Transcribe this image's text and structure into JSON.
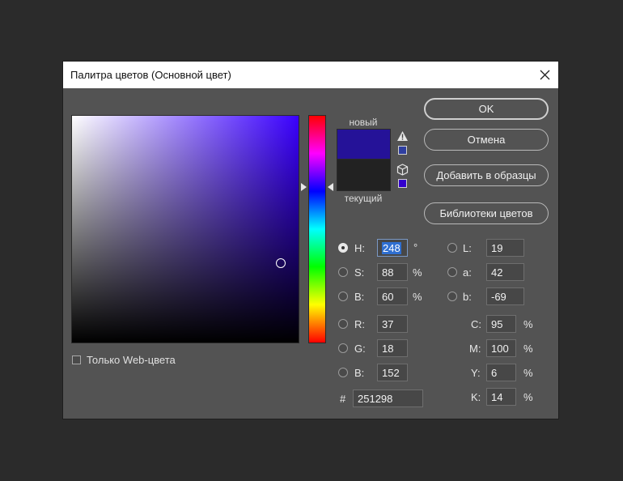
{
  "dialog": {
    "title": "Палитра цветов (Основной цвет)"
  },
  "buttons": {
    "ok": "OK",
    "cancel": "Отмена",
    "add_to_swatches": "Добавить в образцы",
    "color_libraries": "Библиотеки цветов"
  },
  "preview": {
    "new_label": "новый",
    "current_label": "текущий",
    "new_color": "#251298",
    "current_color": "#222222"
  },
  "web_only": {
    "label": "Только Web-цвета",
    "checked": false
  },
  "hsb": {
    "h": {
      "label": "H:",
      "value": "248",
      "unit": "°",
      "selected": true
    },
    "s": {
      "label": "S:",
      "value": "88",
      "unit": "%"
    },
    "b": {
      "label": "B:",
      "value": "60",
      "unit": "%"
    }
  },
  "rgb": {
    "r": {
      "label": "R:",
      "value": "37"
    },
    "g": {
      "label": "G:",
      "value": "18"
    },
    "b": {
      "label": "B:",
      "value": "152"
    }
  },
  "lab": {
    "l": {
      "label": "L:",
      "value": "19"
    },
    "a": {
      "label": "a:",
      "value": "42"
    },
    "b": {
      "label": "b:",
      "value": "-69"
    }
  },
  "cmyk": {
    "c": {
      "label": "C:",
      "value": "95",
      "unit": "%"
    },
    "m": {
      "label": "M:",
      "value": "100",
      "unit": "%"
    },
    "y": {
      "label": "Y:",
      "value": "6",
      "unit": "%"
    },
    "k": {
      "label": "K:",
      "value": "14",
      "unit": "%"
    }
  },
  "hex": {
    "label": "#",
    "value": "251298"
  }
}
